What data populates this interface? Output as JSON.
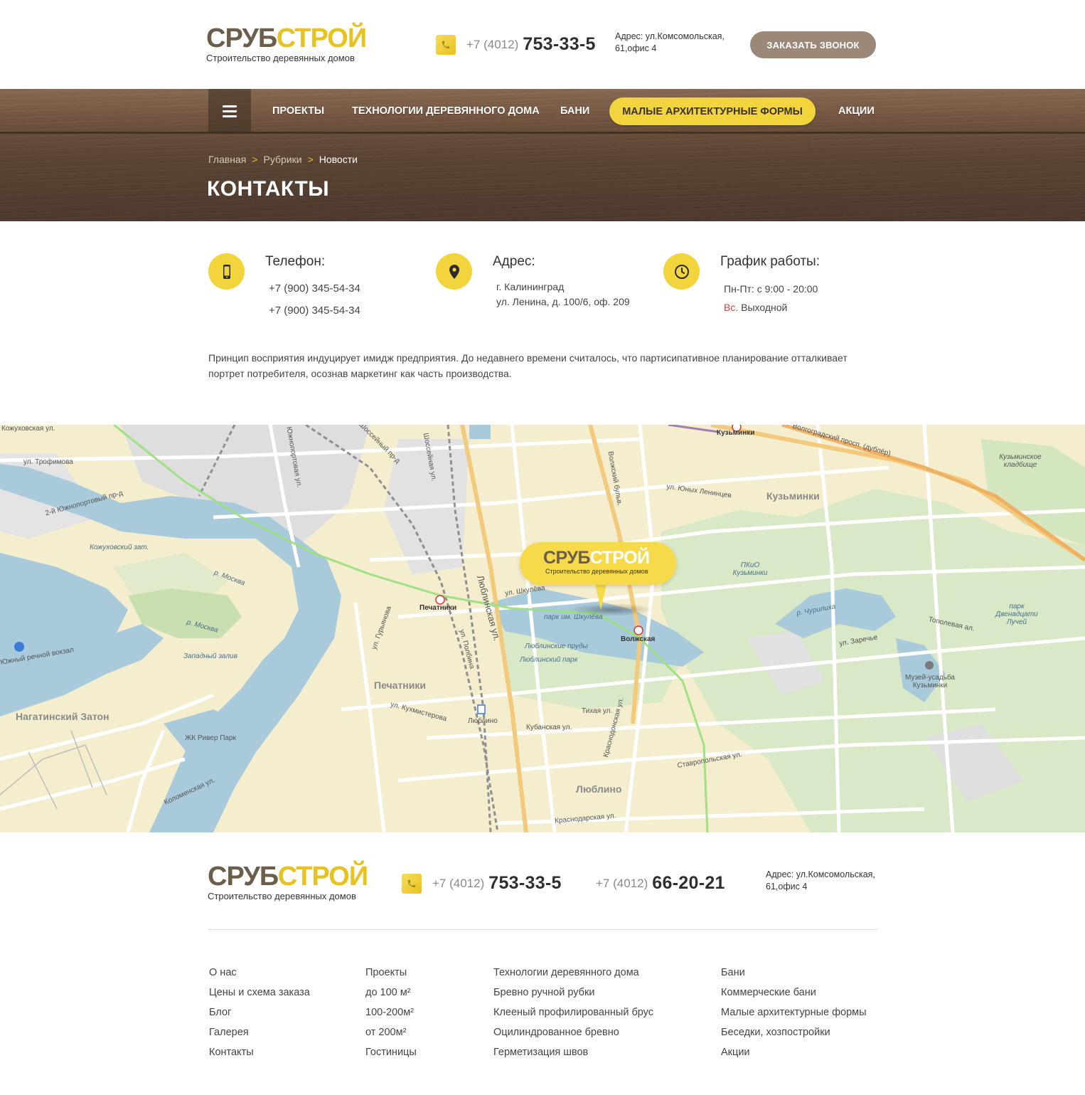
{
  "brand": {
    "word1": "СРУБ",
    "word2": "СТРОЙ",
    "tagline": "Строительство деревянных домов",
    "color_dark": "#6b5f4c",
    "color_accent": "#e8c21f"
  },
  "header": {
    "phone_code": "+7 (4012)",
    "phone_number": "753-33-5",
    "address": "Адрес: ул.Комсомольская, 61,офис 4",
    "callback_label": "ЗАКАЗАТЬ ЗВОНОК"
  },
  "nav": {
    "menu_icon": "hamburger-icon",
    "items": [
      "ПРОЕКТЫ",
      "ТЕХНОЛОГИИ ДЕРЕВЯННОГО ДОМА",
      "БАНИ",
      "МАЛЫЕ АРХИТЕКТУРНЫЕ ФОРМЫ",
      "АКЦИИ"
    ],
    "active_item": "МАЛЫЕ АРХИТЕКТУРНЫЕ ФОРМЫ"
  },
  "breadcrumb": {
    "items": [
      "Главная",
      "Рубрики",
      "Новости"
    ],
    "separator": ">"
  },
  "page_title": "КОНТАКТЫ",
  "contacts": {
    "phone": {
      "title": "Телефон:",
      "icon": "smartphone-icon",
      "lines": [
        "+7 (900) 345-54-34",
        "+7 (900) 345-54-34"
      ]
    },
    "address": {
      "title": "Адрес:",
      "icon": "location-pin-icon",
      "lines": [
        "г. Калининград",
        "ул. Ленина, д. 100/6, оф. 209"
      ]
    },
    "schedule": {
      "title": "График работы:",
      "icon": "clock-icon",
      "weekdays": "Пн-Пт: с 9:00 - 20:00",
      "sunday_day": "Вс.",
      "sunday_text": "Выходной"
    }
  },
  "description": "Принцип восприятия индуцирует имидж предприятия. До недавнего времени считалось, что партисипативное планирование отталкивает портрет потребителя, осознав маркетинг как часть производства.",
  "map": {
    "labels": {
      "kozhukhovskaya": "Кожуховская ул.",
      "trofimova": "ул. Трофимова",
      "yuzhnoportovy2": "2-й Южнопортовый пр-д",
      "kozhukhovsky_zat": "Кожуховский зат.",
      "moskva1": "р. Москва",
      "moskva2": "р. Москва",
      "zapadny_zaliv": "Западный залив",
      "rechnoy_vokzal": "Южный речной вокзал",
      "nagatinsky": "Нагатинский Затон",
      "yuzhnoportovaya": "Южнопортовая ул.",
      "shosseynaya": "Шоссейная ул.",
      "shosseyny_proezd": "Шоссейный пр-д",
      "pechatniki_station": "Печатники",
      "pechatniki_district": "Печатники",
      "lyublinskaya": "Люблинская ул.",
      "polbina": "ул. Полбина",
      "guryanova": "ул. Гурьянова",
      "kukhmisterova": "ул. Кухмистерова",
      "lyublino_station": "Люблино",
      "lyublino_district": "Люблино",
      "krasnodonskaya": "Краснодонская ул.",
      "volzhskaya": "Волжская",
      "volzhsky_bulvar": "Волжский бульв.",
      "shkuleva": "ул. Шкулёва",
      "park_shkuleva": "парк им. Шкулёва",
      "lyublinskie_prudy": "Люблинские пруды",
      "lyublinsky_park": "Люблинский парк",
      "kuzminki_station": "Кузьминки",
      "kuzminki_district": "Кузьминки",
      "yunykh_lenintsev": "ул. Юных Ленинцев",
      "volgogradsky": "Волгоградский просп. (дублёр)",
      "pkio": "ПКиО Кузьминки",
      "park_12": "парк Двенадцати Лучей",
      "muzey": "Музей-усадьба Кузьминки",
      "stavropolskaya": "Ставропольская ул.",
      "krasnodarskaya": "Краснодарская ул.",
      "kubanskaya": "Кубанская ул.",
      "tikhaya": "Тихая ул.",
      "river_park": "ЖК Ривер Парк",
      "kolomenskaya": "Коломенская ул.",
      "topolevaya": "Тополевая ал.",
      "zarechye": "ул. Заречье",
      "churilikha": "р. Чурилиха",
      "kuzminskoe_kladb": "Кузьминское кладбище"
    },
    "marker_word1": "СРУБ",
    "marker_word2": "СТРОЙ",
    "marker_tagline": "Строительство деревянных домов"
  },
  "footer": {
    "phone1_code": "+7 (4012)",
    "phone1_number": "753-33-5",
    "phone2_code": "+7 (4012)",
    "phone2_number": "66-20-21",
    "address": "Адрес: ул.Комсомольская, 61,офис 4",
    "columns": [
      [
        "О нас",
        "Цены и схема заказа",
        "Блог",
        "Галерея",
        "Контакты"
      ],
      [
        "Проекты",
        "до 100 м²",
        "100-200м²",
        "от 200м²",
        "Гостиницы"
      ],
      [
        "Технологии деревянного дома",
        "Бревно ручной рубки",
        "Клееный профилированный брус",
        "Оцилиндрованное бревно",
        "Герметизация швов"
      ],
      [
        "Бани",
        "Коммерческие бани",
        "Малые архитектурные формы",
        "Беседки, хозпостройки",
        "Акции"
      ]
    ]
  }
}
